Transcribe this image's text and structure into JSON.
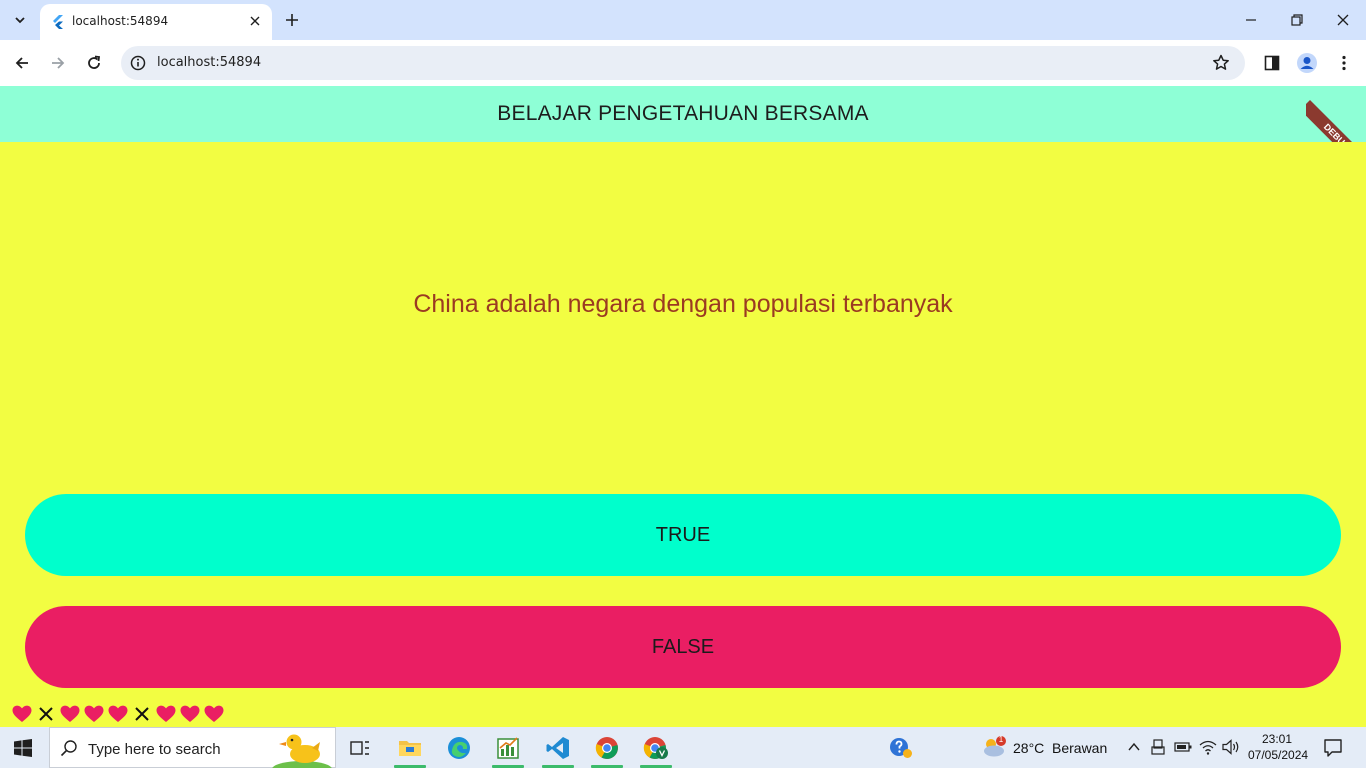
{
  "browser": {
    "tab_title": "localhost:54894",
    "url": "localhost:54894"
  },
  "app": {
    "title": "BELAJAR PENGETAHUAN BERSAMA",
    "debug_banner": "DEBUG",
    "question": "China adalah negara dengan populasi terbanyak",
    "true_label": "TRUE",
    "false_label": "FALSE",
    "score_marks": [
      "heart",
      "cross",
      "heart",
      "heart",
      "heart",
      "cross",
      "heart",
      "heart",
      "heart"
    ],
    "colors": {
      "appbar": "#8effd6",
      "background": "#f2fd42",
      "question_text": "#9b3a22",
      "true_button": "#00ffcc",
      "false_button": "#ea1e63",
      "heart": "#ea1e63"
    }
  },
  "taskbar": {
    "search_placeholder": "Type here to search",
    "weather_temp": "28°C",
    "weather_desc": "Berawan",
    "weather_badge": "1",
    "time": "23:01",
    "date": "07/05/2024"
  }
}
